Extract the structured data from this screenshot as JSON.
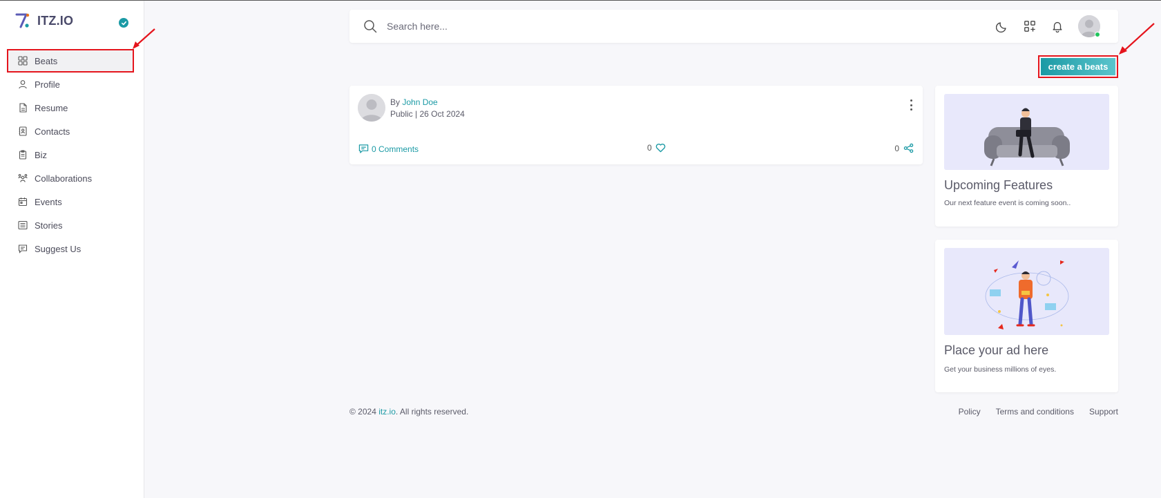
{
  "brand": {
    "name": "ITZ.IO",
    "accent": "#1b9aa5"
  },
  "sidebar": {
    "items": [
      {
        "label": "Beats",
        "icon": "grid-icon",
        "active": true
      },
      {
        "label": "Profile",
        "icon": "user-icon"
      },
      {
        "label": "Resume",
        "icon": "document-icon"
      },
      {
        "label": "Contacts",
        "icon": "contacts-icon"
      },
      {
        "label": "Biz",
        "icon": "clipboard-icon"
      },
      {
        "label": "Collaborations",
        "icon": "group-icon"
      },
      {
        "label": "Events",
        "icon": "calendar-icon"
      },
      {
        "label": "Stories",
        "icon": "list-icon"
      },
      {
        "label": "Suggest Us",
        "icon": "feedback-icon"
      }
    ]
  },
  "header": {
    "search": {
      "placeholder": "Search here...",
      "value": ""
    },
    "icons": [
      "moon-icon",
      "apps-icon",
      "bell-icon",
      "avatar"
    ]
  },
  "actions": {
    "create_label": "create a beats"
  },
  "post": {
    "by_prefix": "By",
    "author": "John Doe",
    "meta": "Public | 26 Oct 2024",
    "comments_label": "0 Comments",
    "likes": "0",
    "shares": "0"
  },
  "ads": [
    {
      "title": "Upcoming Features",
      "description": "Our next feature event is coming soon.."
    },
    {
      "title": "Place your ad here",
      "description": "Get your business millions of eyes."
    }
  ],
  "footer": {
    "copyright_prefix": "© 2024",
    "site_link": "itz.io",
    "copyright_suffix": ". All rights reserved.",
    "links": [
      "Policy",
      "Terms and conditions",
      "Support"
    ]
  },
  "annotation_color": "#e5141c"
}
